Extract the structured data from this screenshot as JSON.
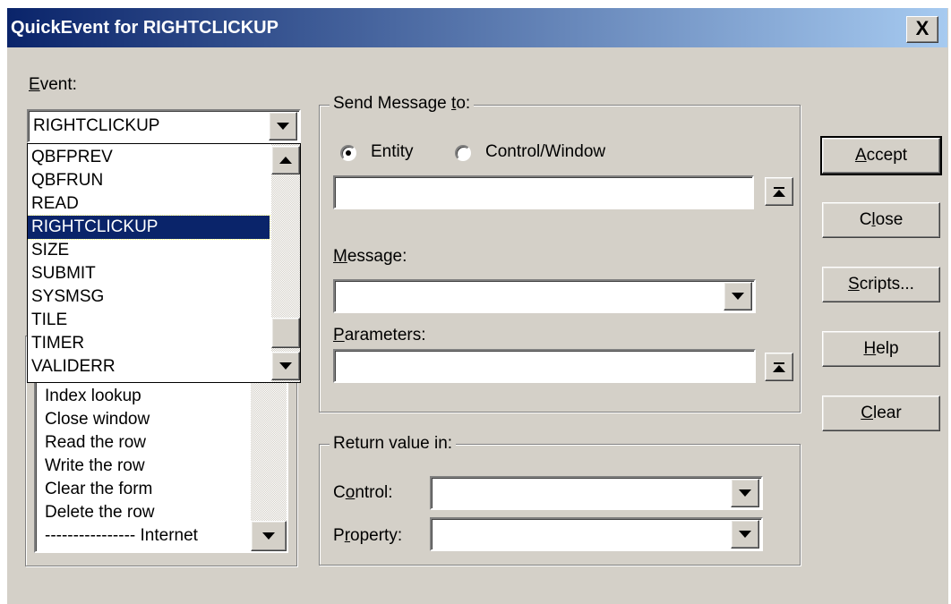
{
  "window": {
    "title": "QuickEvent for RIGHTCLICKUP",
    "close_glyph": "X"
  },
  "event": {
    "label_accel": "E",
    "label_rest": "vent:",
    "selected_value": "RIGHTCLICKUP",
    "dropdown_items": [
      "QBFPREV",
      "QBFRUN",
      "READ",
      "RIGHTCLICKUP",
      "SIZE",
      "SUBMIT",
      "SYSMSG",
      "TILE",
      "TIMER",
      "VALIDERR"
    ],
    "selected_index": 3
  },
  "actions_list": {
    "items": [
      "Index lookup",
      "Close window",
      "Read the row",
      "Write the row",
      "Clear the form",
      "Delete the row",
      "---------------- Internet"
    ]
  },
  "send_message": {
    "group_title_pre": "Send Message ",
    "group_title_accel": "t",
    "group_title_post": "o:",
    "radio_entity": "Entity",
    "radio_control_window": "Control/Window",
    "selected_radio": "Entity",
    "target_value": "",
    "message_label_accel": "M",
    "message_label_rest": "essage:",
    "message_value": "",
    "parameters_label_accel": "P",
    "parameters_label_rest": "arameters:",
    "parameters_value": ""
  },
  "return_value": {
    "group_title": "Return value in:",
    "control_label_pre": "C",
    "control_label_accel": "o",
    "control_label_post": "ntrol:",
    "control_value": "",
    "property_label_pre": "P",
    "property_label_accel": "r",
    "property_label_post": "operty:",
    "property_value": ""
  },
  "buttons": {
    "accept_accel": "A",
    "accept_rest": "ccept",
    "close_pre": "C",
    "close_accel": "l",
    "close_post": "ose",
    "scripts_accel": "S",
    "scripts_rest": "cripts...",
    "help_accel": "H",
    "help_rest": "elp",
    "clear_accel": "C",
    "clear_rest": "lear"
  },
  "colors": {
    "title_bar_start": "#0a246a",
    "title_bar_end": "#a6caf0",
    "face": "#d4d0c8",
    "selection": "#0a246a"
  }
}
